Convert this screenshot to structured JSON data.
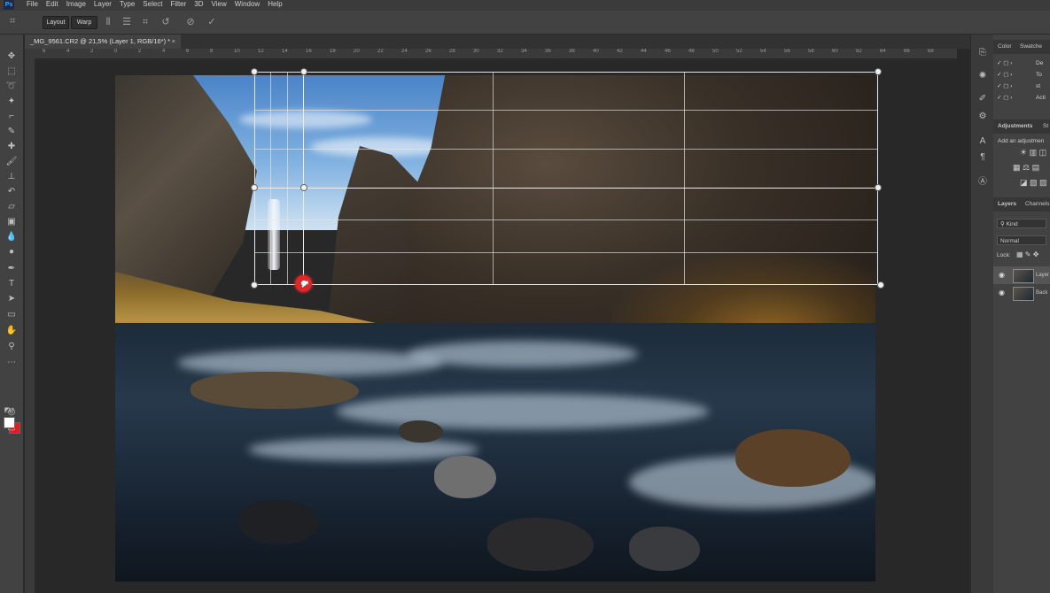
{
  "menubar": {
    "logo": "Ps",
    "items": [
      "File",
      "Edit",
      "Image",
      "Layer",
      "Type",
      "Select",
      "Filter",
      "3D",
      "View",
      "Window",
      "Help"
    ]
  },
  "options": {
    "layout_label": "Layout",
    "warp_label": "Warp"
  },
  "document": {
    "tab_title": "_MG_9561.CR2 @ 21,5% (Layer 1, RGB/16*) *",
    "close": "×"
  },
  "ruler": {
    "top_ticks": [
      "6",
      "4",
      "2",
      "0",
      "2",
      "4",
      "6",
      "8",
      "10",
      "12",
      "14",
      "16",
      "18",
      "20",
      "22",
      "24",
      "26",
      "28",
      "30",
      "32",
      "34",
      "36",
      "38",
      "40",
      "42",
      "44",
      "46",
      "48",
      "50",
      "52",
      "54",
      "56",
      "58",
      "60",
      "62",
      "64",
      "66",
      "68"
    ]
  },
  "panels": {
    "color_tab": "Color",
    "swatches_tab": "Swatche",
    "actions_rows": [
      "De",
      "To",
      "st",
      "Acti"
    ],
    "adjustments_tab": "Adjustments",
    "adjustments_tab2": "St",
    "adjustments_hint": "Add an adjustmen",
    "layers_tab": "Layers",
    "channels_tab": "Channels",
    "kind_label": "Kind",
    "blend_mode": "Normal",
    "lock_label": "Lock:",
    "layers": [
      "Layer",
      "Back"
    ]
  },
  "colors": {
    "foreground": "#ffffff",
    "background": "#e21b1b",
    "cursor_highlight": "#e02626"
  }
}
